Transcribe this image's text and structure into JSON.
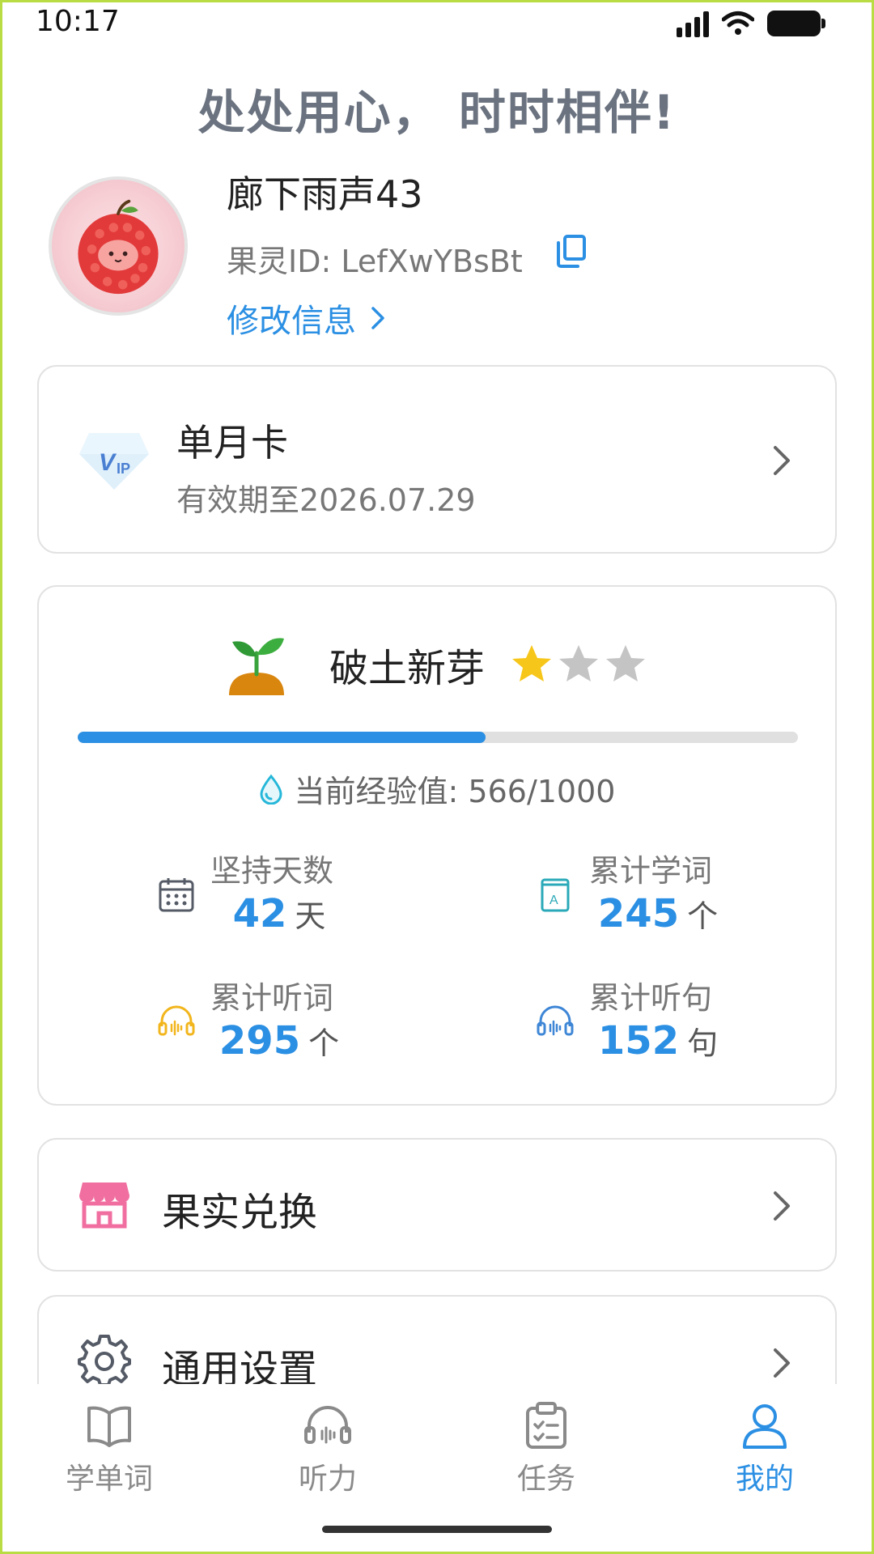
{
  "status_bar": {
    "time": "10:17",
    "icons": [
      "signal-icon",
      "wifi-icon",
      "battery-icon"
    ]
  },
  "slogan": "处处用心， 时时相伴!",
  "profile": {
    "name": "廊下雨声43",
    "id_text": "果灵ID: LefXwYBsBt",
    "edit_label": "修改信息"
  },
  "membership": {
    "title": "单月卡",
    "expiry": "有效期至2026.07.29",
    "icon": "vip-diamond-icon"
  },
  "level": {
    "name": "破土新芽",
    "stars_total": 3,
    "stars_filled": 1,
    "exp_current": 566,
    "exp_max": 1000,
    "exp_text": "当前经验值: 566/1000",
    "progress_fraction": 0.566
  },
  "stats": [
    {
      "label": "坚持天数",
      "value": "42",
      "unit": "天",
      "icon": "calendar-icon"
    },
    {
      "label": "累计学词",
      "value": "245",
      "unit": "个",
      "icon": "book-icon"
    },
    {
      "label": "累计听词",
      "value": "295",
      "unit": "个",
      "icon": "headphones-icon"
    },
    {
      "label": "累计听句",
      "value": "152",
      "unit": "句",
      "icon": "headphones-icon"
    }
  ],
  "menu": [
    {
      "label": "果实兑换",
      "icon": "store-icon"
    },
    {
      "label": "通用设置",
      "icon": "gear-icon"
    }
  ],
  "tabs": [
    {
      "label": "学单词",
      "icon": "book-icon",
      "active": false
    },
    {
      "label": "听力",
      "icon": "headphones-icon",
      "active": false
    },
    {
      "label": "任务",
      "icon": "clipboard-icon",
      "active": false
    },
    {
      "label": "我的",
      "icon": "user-icon",
      "active": true
    }
  ],
  "colors": {
    "accent": "#2b8fe3",
    "star_filled": "#f7c61a",
    "star_empty": "#c4c4c4",
    "store_pink": "#f06fa0"
  }
}
